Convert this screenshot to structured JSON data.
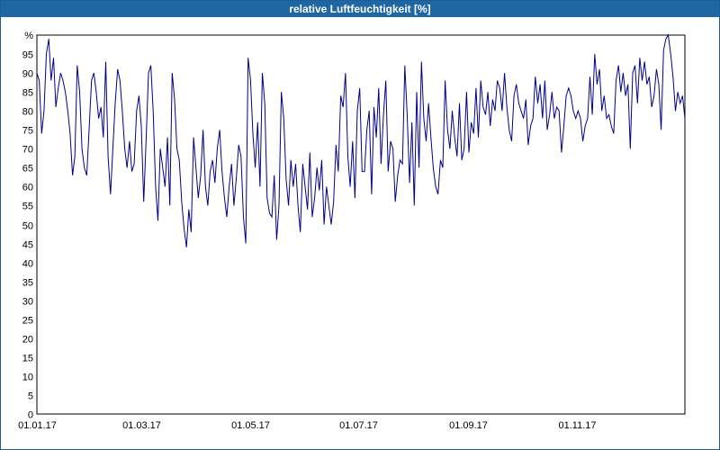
{
  "window": {
    "title": "relative Luftfeuchtigkeit [%]"
  },
  "chart_data": {
    "type": "line",
    "title": "relative Luftfeuchtigkeit [%]",
    "ylabel": "%",
    "xlabel": "",
    "ylim": [
      0,
      100
    ],
    "yticks": [
      0,
      5,
      10,
      15,
      20,
      25,
      30,
      35,
      40,
      45,
      50,
      55,
      60,
      65,
      70,
      75,
      80,
      85,
      90,
      95
    ],
    "x_range": [
      "01.01.17",
      "31.12.17"
    ],
    "xticks": [
      "01.01.17",
      "01.03.17",
      "01.05.17",
      "01.07.17",
      "01.09.17",
      "01.11.17"
    ],
    "grid": true,
    "line_color": "#00008b",
    "series": [
      {
        "name": "",
        "values": [
          90,
          88,
          74,
          80,
          95,
          99,
          88,
          94,
          81,
          86,
          90,
          88,
          85,
          80,
          74,
          63,
          68,
          92,
          85,
          70,
          65,
          63,
          75,
          88,
          90,
          85,
          78,
          81,
          73,
          93,
          68,
          58,
          70,
          82,
          91,
          88,
          80,
          70,
          65,
          72,
          64,
          66,
          80,
          84,
          76,
          56,
          72,
          90,
          92,
          80,
          60,
          51,
          70,
          65,
          60,
          73,
          55,
          90,
          83,
          70,
          67,
          56,
          49,
          44,
          54,
          48,
          73,
          65,
          57,
          63,
          75,
          60,
          55,
          64,
          67,
          61,
          70,
          75,
          64,
          57,
          52,
          60,
          66,
          55,
          62,
          71,
          68,
          52,
          45,
          94,
          88,
          74,
          65,
          77,
          60,
          90,
          82,
          57,
          53,
          52,
          63,
          46,
          55,
          85,
          78,
          62,
          55,
          67,
          60,
          66,
          55,
          48,
          66,
          60,
          54,
          69,
          52,
          57,
          65,
          59,
          67,
          50,
          60,
          55,
          50,
          56,
          71,
          64,
          84,
          81,
          90,
          68,
          60,
          72,
          57,
          80,
          86,
          64,
          64,
          75,
          80,
          58,
          81,
          73,
          86,
          66,
          79,
          88,
          64,
          72,
          70,
          56,
          63,
          67,
          66,
          92,
          79,
          61,
          77,
          55,
          85,
          65,
          93,
          78,
          72,
          82,
          73,
          65,
          60,
          58,
          67,
          65,
          88,
          75,
          70,
          80,
          73,
          68,
          82,
          67,
          70,
          85,
          69,
          77,
          74,
          86,
          73,
          88,
          81,
          79,
          85,
          76,
          83,
          80,
          88,
          86,
          80,
          90,
          81,
          75,
          72,
          84,
          87,
          82,
          80,
          78,
          83,
          71,
          76,
          78,
          89,
          82,
          87,
          78,
          88,
          75,
          79,
          85,
          78,
          81,
          80,
          69,
          76,
          84,
          86,
          84,
          80,
          78,
          80,
          78,
          72,
          76,
          78,
          89,
          79,
          95,
          87,
          91,
          80,
          84,
          78,
          79,
          76,
          74,
          88,
          92,
          85,
          90,
          84,
          87,
          70,
          90,
          92,
          82,
          94,
          88,
          93,
          87,
          89,
          81,
          84,
          91,
          87,
          75,
          96,
          99,
          100,
          95,
          89,
          80,
          85,
          82,
          84,
          78
        ]
      }
    ]
  }
}
